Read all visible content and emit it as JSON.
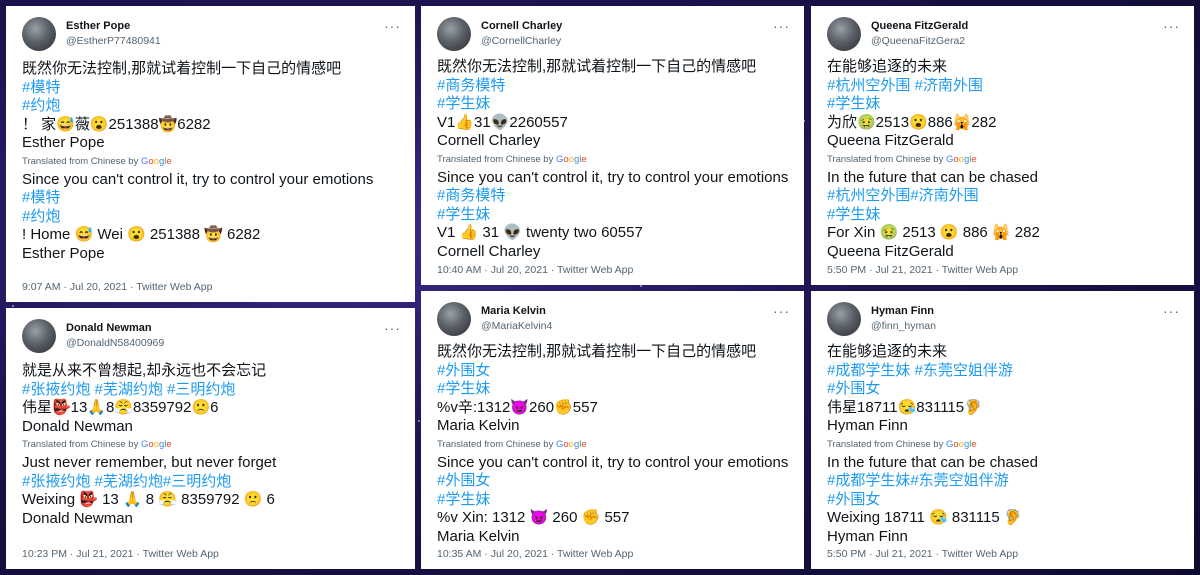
{
  "google": [
    "G",
    "o",
    "o",
    "g",
    "l",
    "e"
  ],
  "tweets": [
    {
      "display_name": "Esther Pope",
      "handle": "@EstherP77480941",
      "original_lines": [
        "既然你无法控制,那就试着控制一下自己的情感吧"
      ],
      "tag_lines": [
        " #模特",
        " #约炮"
      ],
      "emoji_line": "！ 家😅薇😮251388🤠6282",
      "sig": "Esther Pope",
      "translated_label": "Translated from Chinese by",
      "translation": "Since you can't control it, try to control your emotions",
      "trans_tags": [
        "#模特",
        "#约炮"
      ],
      "trans_emoji": " ! Home 😅 Wei 😮 251388 🤠 6282",
      "trans_sig": " Esther Pope",
      "timestamp": "9:07 AM · Jul 20, 2021 · Twitter Web App",
      "more": "···"
    },
    {
      "display_name": "Donald Newman",
      "handle": "@DonaldN58400969",
      "original_lines": [
        "就是从来不曾想起,却永远也不会忘记"
      ],
      "tag_lines": [
        "#张掖约炮 #芜湖约炮 #三明约炮"
      ],
      "emoji_line": "伟星👺13🙏8😤8359792🙁6",
      "sig": "Donald Newman",
      "translated_label": "Translated from Chinese by",
      "translation": "Just never remember, but never forget",
      "trans_tags": [
        "#张掖约炮 #芜湖约炮#三明约炮"
      ],
      "trans_emoji": " Weixing 👺 13 🙏 8 😤 8359792 🙁 6",
      "trans_sig": " Donald Newman",
      "timestamp": "10:23 PM · Jul 21, 2021 · Twitter Web App",
      "more": "···"
    },
    {
      "display_name": "Cornell Charley",
      "handle": "@CornellCharley",
      "original_lines": [
        "既然你无法控制,那就试着控制一下自己的情感吧"
      ],
      "tag_lines": [
        " #商务模特",
        " #学生妹"
      ],
      "emoji_line": "V1👍31👽2260557",
      "sig": "Cornell Charley",
      "translated_label": "Translated from Chinese by",
      "translation": "Since you can't control it, try to control your emotions",
      "trans_tags": [
        "#商务模特",
        "#学生妹"
      ],
      "trans_emoji": " V1 👍 31 👽 twenty two  60557",
      "trans_sig": " Cornell Charley",
      "timestamp": "10:40 AM · Jul 20, 2021 · Twitter Web App",
      "more": "···"
    },
    {
      "display_name": "Maria Kelvin",
      "handle": "@MariaKelvin4",
      "original_lines": [
        "既然你无法控制,那就试着控制一下自己的情感吧"
      ],
      "tag_lines": [
        " #外围女",
        " #学生妹"
      ],
      "emoji_line": "%v辛:1312😈260✊557",
      "sig": "Maria Kelvin",
      "translated_label": "Translated from Chinese by",
      "translation": "Since you can't control it, try to control your emotions",
      "trans_tags": [
        "#外围女",
        "#学生妹"
      ],
      "trans_emoji": " %v Xin: 1312 😈 260 ✊ 557",
      "trans_sig": " Maria Kelvin",
      "timestamp": "10:35 AM · Jul 20, 2021 · Twitter Web App",
      "more": "···"
    },
    {
      "display_name": "Queena FitzGerald",
      "handle": "@QueenaFitzGera2",
      "original_lines": [
        "在能够追逐的未来"
      ],
      "tag_lines": [
        " #杭州空外围 #济南外围",
        " #学生妹"
      ],
      "emoji_line": "为欣🤢2513😮886🙀282",
      "sig": "Queena FitzGerald",
      "translated_label": "Translated from Chinese by",
      "translation": "In the future that can be chased",
      "trans_tags": [
        "#杭州空外围#济南外围",
        "#学生妹"
      ],
      "trans_emoji": " For Xin 🤢 2513 😮 886 🙀 282",
      "trans_sig": " Queena FitzGerald",
      "timestamp": "5:50 PM · Jul 21, 2021 · Twitter Web App",
      "more": "···"
    },
    {
      "display_name": "Hyman Finn",
      "handle": "@finn_hyman",
      "original_lines": [
        "在能够追逐的未来"
      ],
      "tag_lines": [
        " #成都学生妹 #东莞空姐伴游",
        " #外围女"
      ],
      "emoji_line": "伟星18711😪831115🦻",
      "sig": "Hyman Finn",
      "translated_label": "Translated from Chinese by",
      "translation": "In the future that can be chased",
      "trans_tags": [
        "#成都学生妹#东莞空姐伴游",
        "#外围女"
      ],
      "trans_emoji": " Weixing 18711 😪 831115 🦻",
      "trans_sig": " Hyman Finn",
      "timestamp": "5:50 PM · Jul 21, 2021 · Twitter Web App",
      "more": "···"
    }
  ]
}
